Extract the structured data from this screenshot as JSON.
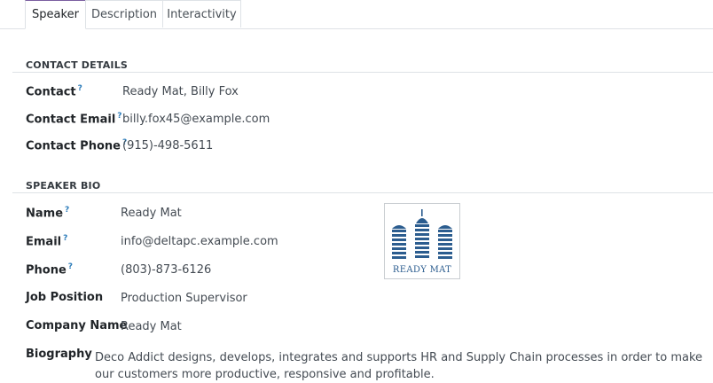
{
  "tabs": [
    {
      "label": "Speaker",
      "active": true
    },
    {
      "label": "Description",
      "active": false
    },
    {
      "label": "Interactivity",
      "active": false
    }
  ],
  "contact_details": {
    "title": "CONTACT DETAILS",
    "help_mark": "?",
    "contact_label": "Contact",
    "contact_value": "Ready Mat, Billy Fox",
    "email_label": "Contact Email",
    "email_value": "billy.fox45@example.com",
    "phone_label": "Contact Phone",
    "phone_value": "(915)-498-5611"
  },
  "speaker_bio": {
    "title": "SPEAKER BIO",
    "name_label": "Name",
    "name_value": "Ready Mat",
    "email_label": "Email",
    "email_value": "info@deltapc.example.com",
    "phone_label": "Phone",
    "phone_value": "(803)-873-6126",
    "job_label": "Job Position",
    "job_value": "Production Supervisor",
    "company_label": "Company Name",
    "company_value": "Ready Mat",
    "biography_label": "Biography",
    "biography_value": "Deco Addict designs, develops, integrates and supports HR and Supply Chain processes in order to make our customers more productive, responsive and profitable."
  },
  "logo": {
    "text": "READY MAT",
    "color": "#2c5d8f"
  },
  "colors": {
    "accent_tab_top": "#7a5ea0",
    "help_mark": "#2b7bb9"
  }
}
